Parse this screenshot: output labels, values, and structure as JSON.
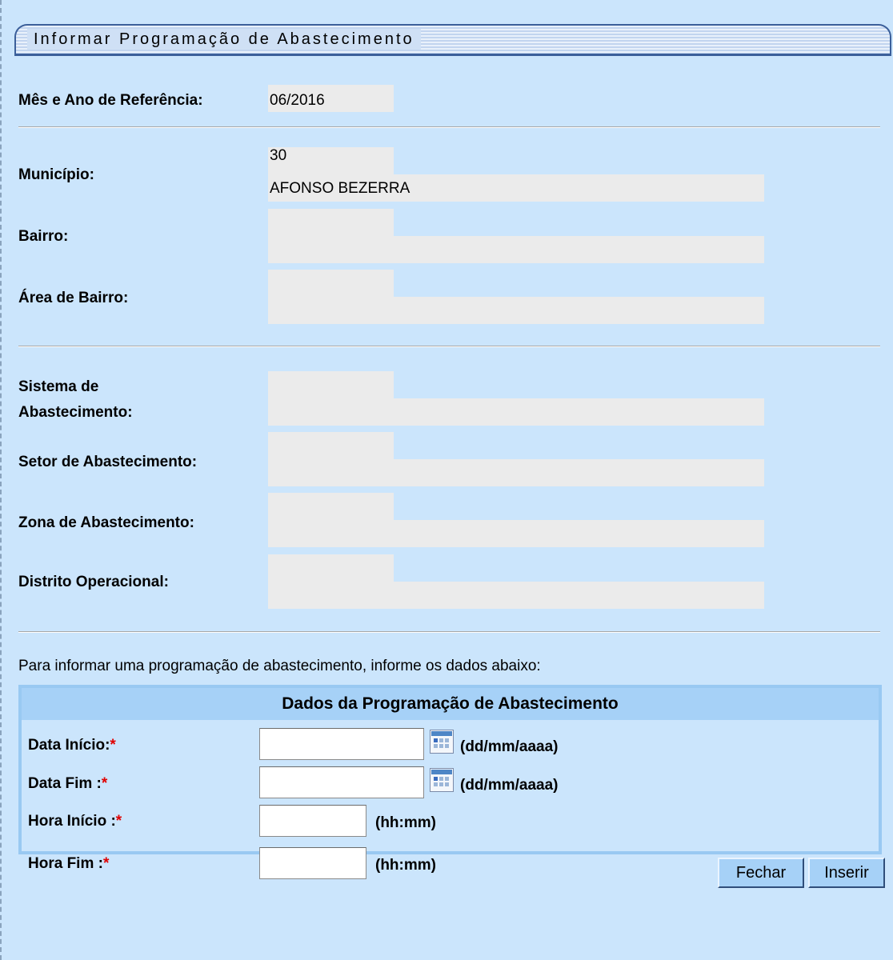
{
  "title": "Informar Programação de Abastecimento",
  "fields": {
    "mes_ano": {
      "label": "Mês e Ano de Referência:",
      "value": "06/2016"
    },
    "municipio": {
      "label": "Município:",
      "code": "30",
      "name": "AFONSO BEZERRA"
    },
    "bairro": {
      "label": "Bairro:",
      "code": "",
      "name": ""
    },
    "area_bairro": {
      "label": "Área de Bairro:",
      "code": "",
      "name": ""
    },
    "sistema_line1": "Sistema de",
    "sistema_line2": "Abastecimento:",
    "sistema": {
      "code": "",
      "name": ""
    },
    "setor": {
      "label": "Setor de Abastecimento:",
      "code": "",
      "name": ""
    },
    "zona": {
      "label": "Zona de Abastecimento:",
      "code": "",
      "name": ""
    },
    "distrito": {
      "label": "Distrito Operacional:",
      "code": "",
      "name": ""
    }
  },
  "intro": "Para informar uma programação de abastecimento, informe os dados abaixo:",
  "panel": {
    "header": "Dados da Programação de Abastecimento",
    "data_inicio": {
      "label": "Data Início:",
      "value": "",
      "format": "(dd/mm/aaaa)"
    },
    "data_fim": {
      "label": "Data Fim :",
      "value": "",
      "format": "(dd/mm/aaaa)"
    },
    "hora_inicio": {
      "label": "Hora Início :",
      "value": "",
      "format": "(hh:mm)"
    },
    "hora_fim": {
      "label": "Hora Fim :",
      "value": "",
      "format": "(hh:mm)"
    },
    "required_marker": "*"
  },
  "buttons": {
    "fechar": "Fechar",
    "inserir": "Inserir"
  },
  "icons": {
    "calendar": "calendar-icon"
  },
  "colors": {
    "background": "#cbe5fc",
    "panel_header": "#a6d1f7",
    "required": "#e00000"
  }
}
